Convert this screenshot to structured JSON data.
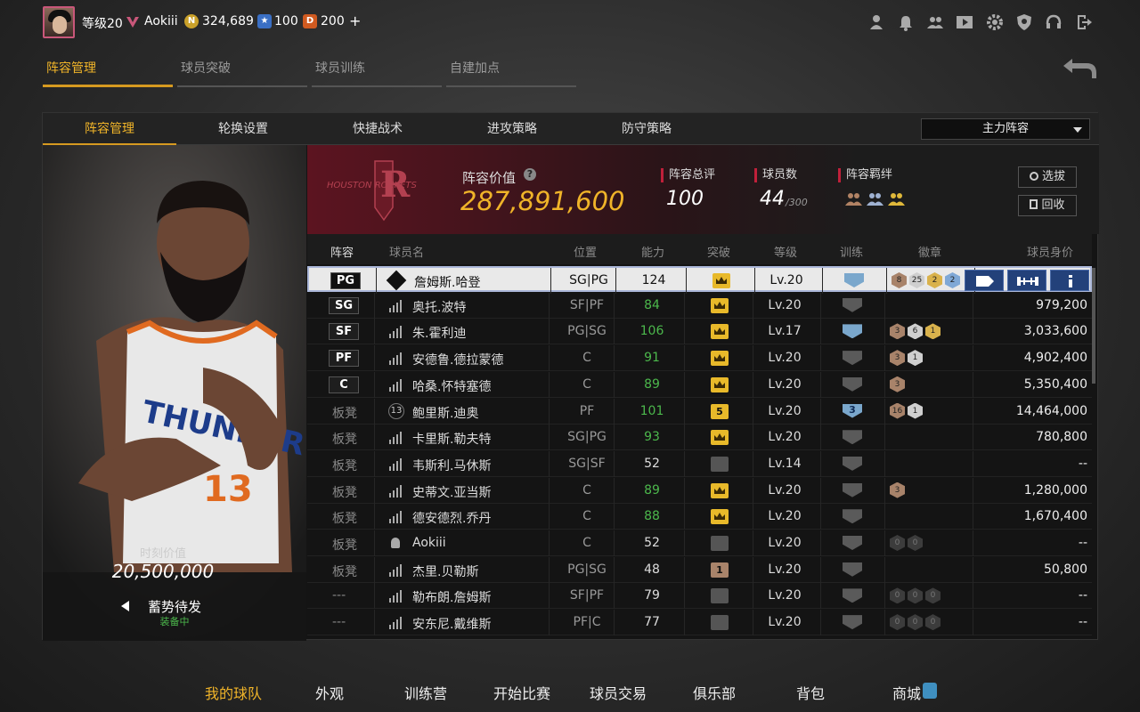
{
  "topbar": {
    "level": "等级20",
    "username": "Aokiii",
    "coins": "324,689",
    "stars": "100",
    "points": "200",
    "plus": "+",
    "icons": [
      "profile-icon",
      "bell-icon",
      "friends-icon",
      "video-icon",
      "gear-icon",
      "shield-icon",
      "headset-icon",
      "exit-icon"
    ]
  },
  "subtabs": [
    "阵容管理",
    "球员突破",
    "球员训练",
    "自建加点"
  ],
  "innertabs": [
    "阵容管理",
    "轮换设置",
    "快捷战术",
    "进攻策略",
    "防守策略"
  ],
  "lineup_select": "主力阵容",
  "portrait": {
    "value_label": "时刻价值",
    "value": "20,500,000",
    "status": "蓄势待发",
    "substatus": "装备中",
    "jersey": "THUNDER",
    "number": "13"
  },
  "team": {
    "logo_text": "HOUSTON ROCKETS",
    "value_label": "阵容价值",
    "value": "287,891,600",
    "rating_label": "阵容总评",
    "rating": "100",
    "count_label": "球员数",
    "count": "44",
    "count_max": "/300",
    "bond_label": "阵容羁绊",
    "btn_pick": "选拔",
    "btn_recycle": "回收"
  },
  "table": {
    "headers": [
      "阵容",
      "球员名",
      "位置",
      "能力",
      "突破",
      "等级",
      "训练",
      "徽章",
      "球员身价"
    ],
    "rows": [
      {
        "slot": "PG",
        "name": "詹姆斯.哈登",
        "pos": "SG|PG",
        "ability": "124",
        "brk": "crown",
        "level": "Lv.20",
        "train": "blue",
        "badges": [
          [
            "8",
            "bronze"
          ],
          [
            "25",
            "silver"
          ],
          [
            "2",
            "gold"
          ],
          [
            "2",
            "blue"
          ]
        ],
        "price": "",
        "sel": true
      },
      {
        "slot": "SG",
        "name": "奥托.波特",
        "pos": "SF|PF",
        "ability": "84",
        "brk": "crown",
        "level": "Lv.20",
        "train": "grey",
        "badges": [],
        "price": "979,200"
      },
      {
        "slot": "SF",
        "name": "朱.霍利迪",
        "pos": "PG|SG",
        "ability": "106",
        "brk": "crown",
        "level": "Lv.17",
        "train": "blue",
        "badges": [
          [
            "3",
            "bronze"
          ],
          [
            "6",
            "silver"
          ],
          [
            "1",
            "gold"
          ]
        ],
        "price": "3,033,600"
      },
      {
        "slot": "PF",
        "name": "安德鲁.德拉蒙德",
        "pos": "C",
        "ability": "91",
        "brk": "crown",
        "level": "Lv.20",
        "train": "grey",
        "badges": [
          [
            "3",
            "bronze"
          ],
          [
            "1",
            "silver"
          ]
        ],
        "price": "4,902,400"
      },
      {
        "slot": "C",
        "name": "哈桑.怀特塞德",
        "pos": "C",
        "ability": "89",
        "brk": "crown",
        "level": "Lv.20",
        "train": "grey",
        "badges": [
          [
            "3",
            "bronze"
          ]
        ],
        "price": "5,350,400"
      },
      {
        "slot": "板凳",
        "name": "鲍里斯.迪奥",
        "pos": "PF",
        "ability": "101",
        "brk": "5",
        "level": "Lv.20",
        "train": "3",
        "badges": [
          [
            "16",
            "bronze"
          ],
          [
            "1",
            "silver"
          ]
        ],
        "price": "14,464,000"
      },
      {
        "slot": "板凳",
        "name": "卡里斯.勒夫特",
        "pos": "SG|PG",
        "ability": "93",
        "brk": "crown",
        "level": "Lv.20",
        "train": "grey",
        "badges": [],
        "price": "780,800"
      },
      {
        "slot": "板凳",
        "name": "韦斯利.马休斯",
        "pos": "SG|SF",
        "ability": "52",
        "brk": "grey",
        "level": "Lv.14",
        "train": "grey",
        "badges": [],
        "price": "--"
      },
      {
        "slot": "板凳",
        "name": "史蒂文.亚当斯",
        "pos": "C",
        "ability": "89",
        "brk": "crown",
        "level": "Lv.20",
        "train": "grey",
        "badges": [
          [
            "3",
            "bronze"
          ]
        ],
        "price": "1,280,000"
      },
      {
        "slot": "板凳",
        "name": "德安德烈.乔丹",
        "pos": "C",
        "ability": "88",
        "brk": "crown",
        "level": "Lv.20",
        "train": "grey",
        "badges": [],
        "price": "1,670,400"
      },
      {
        "slot": "板凳",
        "name": "Aokiii",
        "pos": "C",
        "ability": "52",
        "brk": "grey",
        "level": "Lv.20",
        "train": "grey",
        "badges": [
          [
            "0",
            "dark"
          ],
          [
            "0",
            "dark"
          ]
        ],
        "price": "--"
      },
      {
        "slot": "板凳",
        "name": "杰里.贝勒斯",
        "pos": "PG|SG",
        "ability": "48",
        "brk": "1",
        "level": "Lv.20",
        "train": "grey",
        "badges": [],
        "price": "50,800"
      },
      {
        "slot": "---",
        "name": "勒布朗.詹姆斯",
        "pos": "SF|PF",
        "ability": "79",
        "brk": "grey",
        "level": "Lv.20",
        "train": "grey",
        "badges": [
          [
            "0",
            "dark"
          ],
          [
            "0",
            "dark"
          ],
          [
            "0",
            "dark"
          ]
        ],
        "price": "--"
      },
      {
        "slot": "---",
        "name": "安东尼.戴维斯",
        "pos": "PF|C",
        "ability": "77",
        "brk": "grey",
        "level": "Lv.20",
        "train": "grey",
        "badges": [
          [
            "0",
            "dark"
          ],
          [
            "0",
            "dark"
          ],
          [
            "0",
            "dark"
          ]
        ],
        "price": "--"
      }
    ]
  },
  "bottomnav": [
    "我的球队",
    "外观",
    "训练营",
    "开始比赛",
    "球员交易",
    "俱乐部",
    "背包",
    "商城"
  ],
  "colors": {
    "accent": "#f0b429",
    "green": "#4cb84c",
    "red": "#c0203a"
  }
}
